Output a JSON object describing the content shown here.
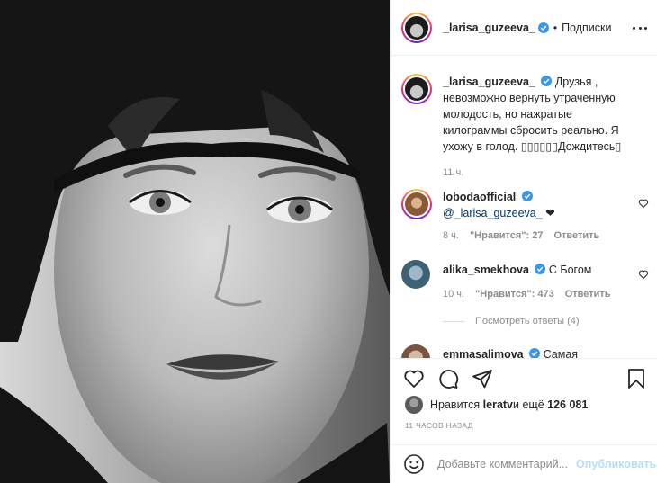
{
  "post": {
    "image_alt": "black-and-white portrait"
  },
  "header": {
    "username": "_larisa_guzeeva_",
    "separator": "•",
    "follow_label": "Подписки"
  },
  "caption": {
    "username": "_larisa_guzeeva_",
    "text": "Друзья , невозможно вернуть утраченную молодость, но нажратые килограммы сбросить реально. Я ухожу в голод. ▯▯▯▯▯▯Дождитесь▯",
    "time": "11 ч."
  },
  "comments": [
    {
      "username": "lobodaofficial",
      "mention": "@_larisa_guzeeva_",
      "text": " ❤",
      "time": "8 ч.",
      "likes_label": "\"Нравится\": 27",
      "reply_label": "Ответить"
    },
    {
      "username": "alika_smekhova",
      "mention": "",
      "text": "С Богом",
      "time": "10 ч.",
      "likes_label": "\"Нравится\": 473",
      "reply_label": "Ответить",
      "view_replies": "Посмотреть ответы (4)"
    },
    {
      "username": "emmasalimova",
      "text": "Самая"
    }
  ],
  "actions": {
    "likes_prefix": "Нравится ",
    "likes_user": "leratv",
    "likes_middle": " и ещё ",
    "likes_count": "126 081",
    "timestamp": "11 ЧАСОВ НАЗАД",
    "comment_placeholder": "Добавьте комментарий...",
    "publish_label": "Опубликовать"
  },
  "colors": {
    "verified": "#3897f0",
    "link": "#00376b",
    "muted": "#8e8e8e",
    "publish_disabled": "#b2dffc"
  }
}
